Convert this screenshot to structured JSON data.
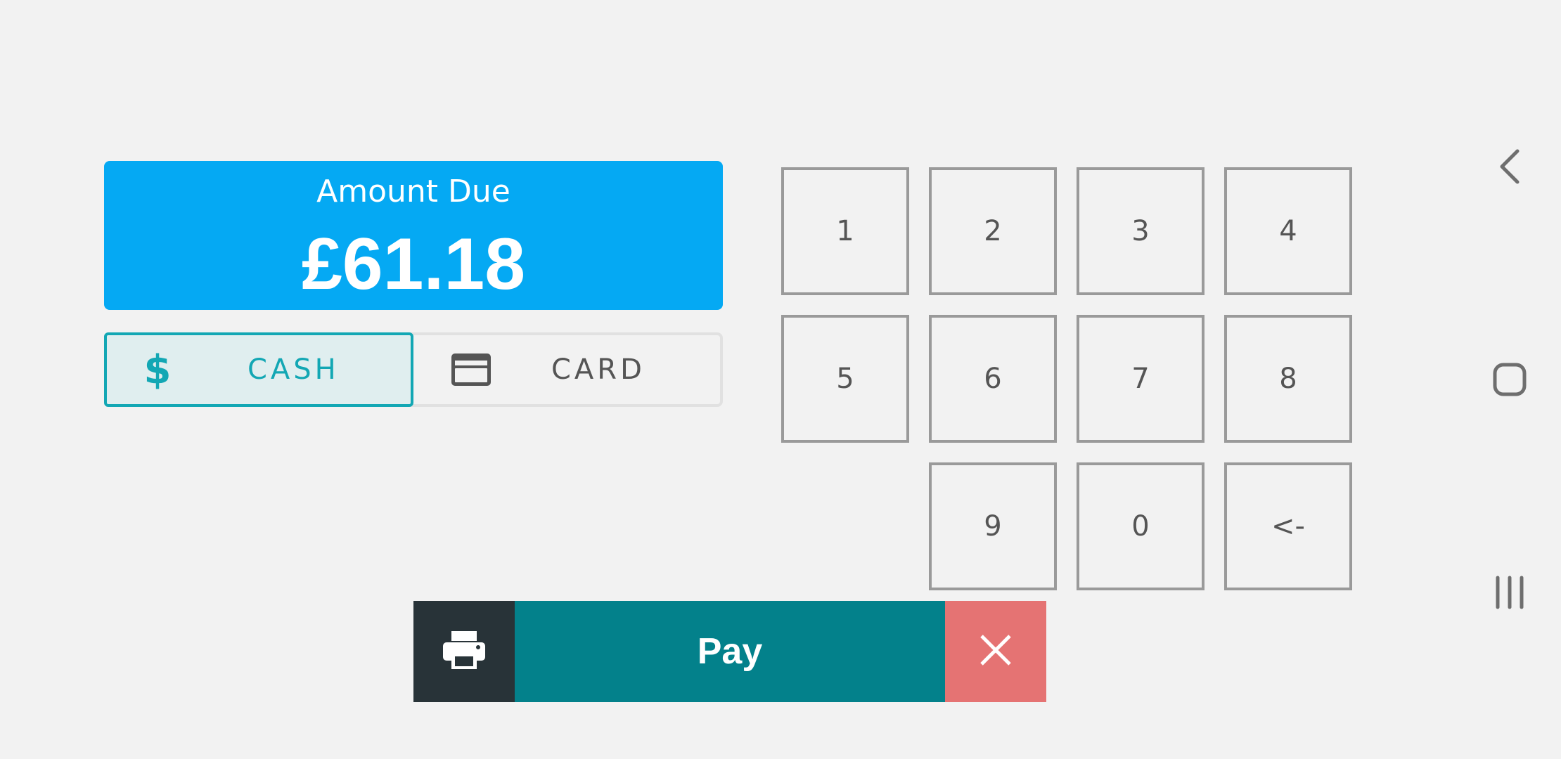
{
  "amount": {
    "label": "Amount Due",
    "value": "£61.18"
  },
  "payment_methods": {
    "selected": "cash",
    "cash": {
      "label": "CASH",
      "icon": "dollar-icon",
      "glyph": "$"
    },
    "card": {
      "label": "CARD",
      "icon": "credit-card-icon"
    }
  },
  "keypad": {
    "keys": [
      "1",
      "2",
      "3",
      "4",
      "5",
      "6",
      "7",
      "8",
      "9",
      "0",
      "<-"
    ]
  },
  "actions": {
    "print_icon": "printer-icon",
    "pay_label": "Pay",
    "cancel_icon": "close-icon"
  },
  "system_nav": {
    "back_icon": "back-chevron-icon",
    "home_icon": "home-square-icon",
    "recents_icon": "recents-icon"
  },
  "colors": {
    "amount_panel": "#05a9f3",
    "cash_accent": "#13a7b4",
    "pay_button": "#03818b",
    "print_button": "#283338",
    "cancel_button": "#e57373",
    "background": "#f2f2f2"
  }
}
